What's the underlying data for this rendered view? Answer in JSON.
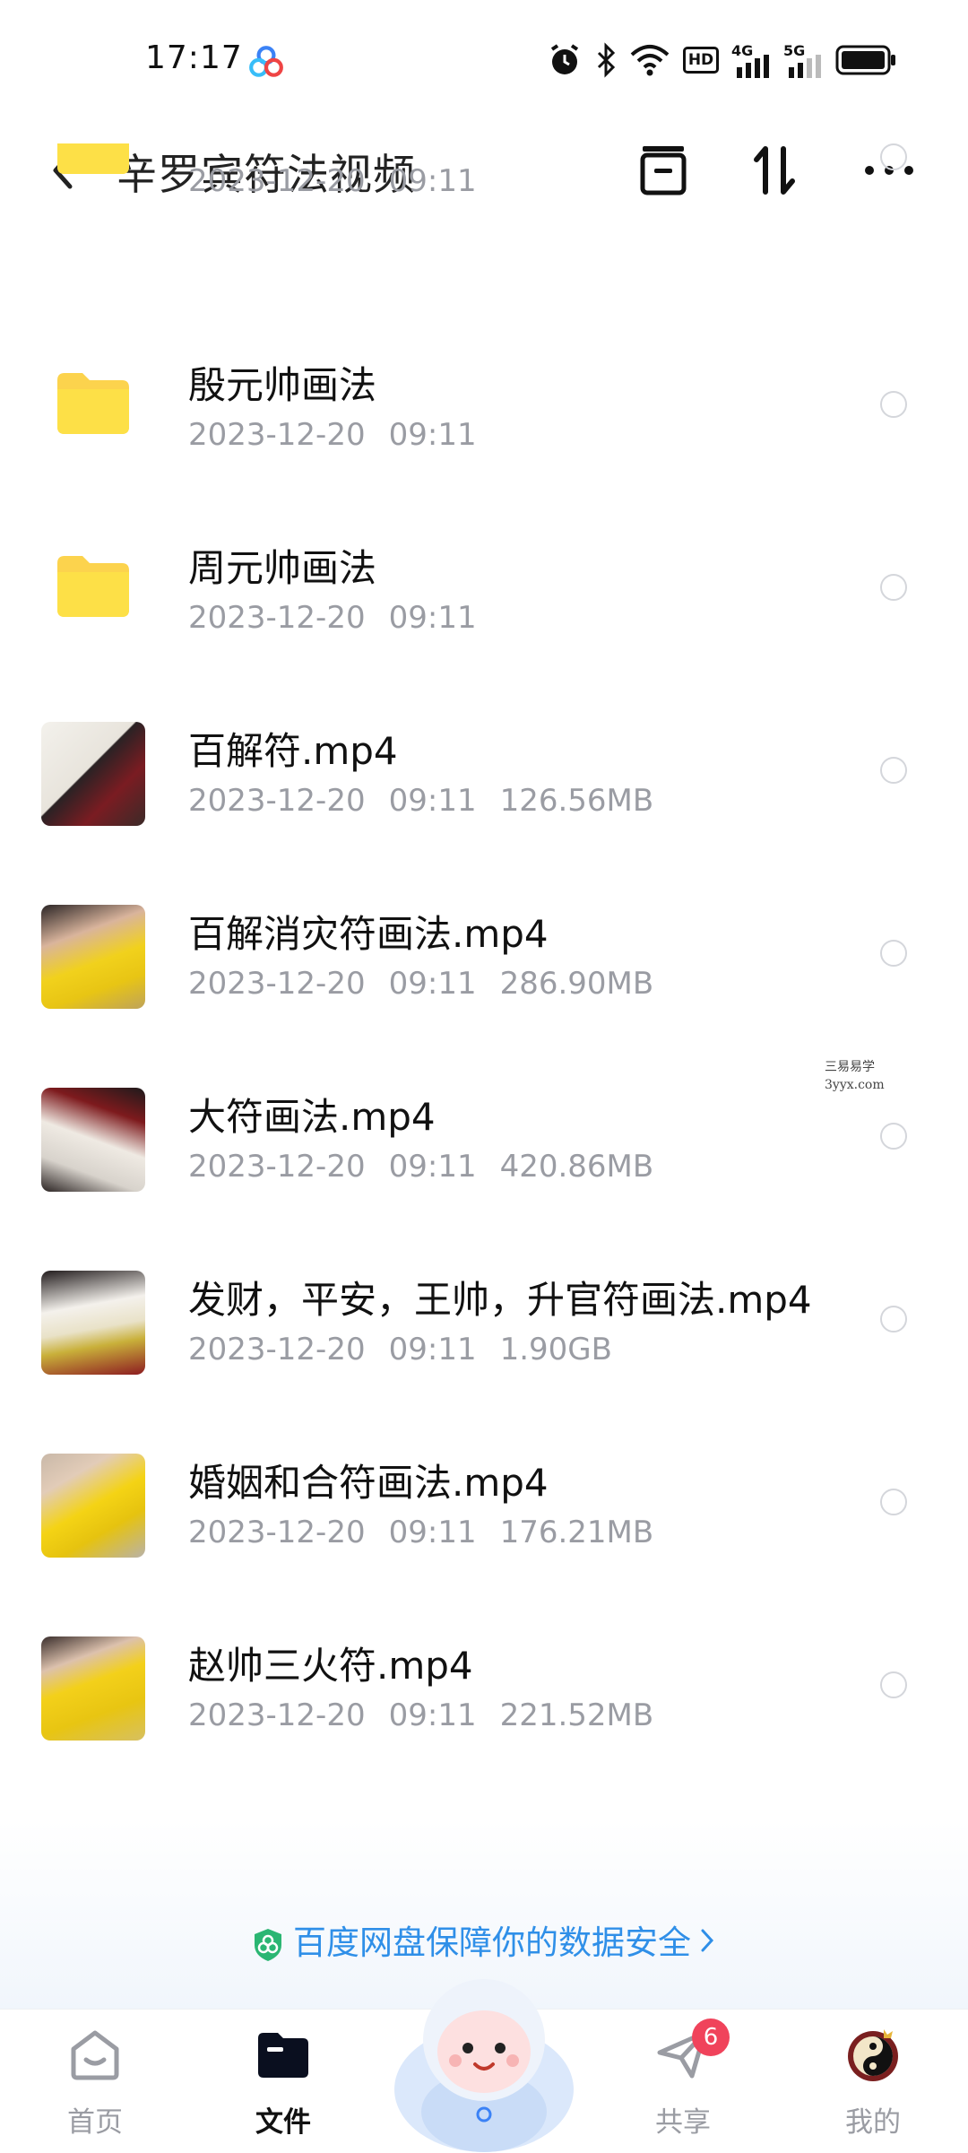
{
  "status_bar": {
    "time": "17:17",
    "icons": [
      "baidu-netdisk-icon",
      "alarm-icon",
      "bluetooth-icon",
      "wifi-icon",
      "hd-icon",
      "signal-4g-icon",
      "signal-5g-icon",
      "battery-icon"
    ],
    "hd_label": "HD",
    "net1": "4G",
    "net2": "5G"
  },
  "header": {
    "title": "辛罗宾符法视频",
    "actions": [
      "select-all-icon",
      "sort-icon",
      "more-icon"
    ]
  },
  "files": [
    {
      "name": "",
      "date": "2023-12-20",
      "time": "09:11",
      "size": "",
      "type": "folder"
    },
    {
      "name": "殷元帅画法",
      "date": "2023-12-20",
      "time": "09:11",
      "size": "",
      "type": "folder"
    },
    {
      "name": "周元帅画法",
      "date": "2023-12-20",
      "time": "09:11",
      "size": "",
      "type": "folder"
    },
    {
      "name": "百解符.mp4",
      "date": "2023-12-20",
      "time": "09:11",
      "size": "126.56MB",
      "type": "video"
    },
    {
      "name": "百解消灾符画法.mp4",
      "date": "2023-12-20",
      "time": "09:11",
      "size": "286.90MB",
      "type": "video"
    },
    {
      "name": "大符画法.mp4",
      "date": "2023-12-20",
      "time": "09:11",
      "size": "420.86MB",
      "type": "video"
    },
    {
      "name": "发财，平安，王帅，升官符画法.mp4",
      "date": "2023-12-20",
      "time": "09:11",
      "size": "1.90GB",
      "type": "video"
    },
    {
      "name": "婚姻和合符画法.mp4",
      "date": "2023-12-20",
      "time": "09:11",
      "size": "176.21MB",
      "type": "video"
    },
    {
      "name": "赵帅三火符.mp4",
      "date": "2023-12-20",
      "time": "09:11",
      "size": "221.52MB",
      "type": "video"
    }
  ],
  "watermark": {
    "line1": "三易易学",
    "line2": "3yyx.com"
  },
  "security_banner": "百度网盘保障你的数据安全",
  "tabs": [
    {
      "label": "首页",
      "icon": "home-icon"
    },
    {
      "label": "文件",
      "icon": "folder-icon"
    },
    {
      "label": "共享",
      "icon": "share-icon",
      "badge": "6"
    },
    {
      "label": "我的",
      "icon": "avatar-icon"
    }
  ],
  "colors": {
    "accent": "#2f8fe8",
    "folder": "#fcd34d",
    "badge": "#f0435b"
  }
}
